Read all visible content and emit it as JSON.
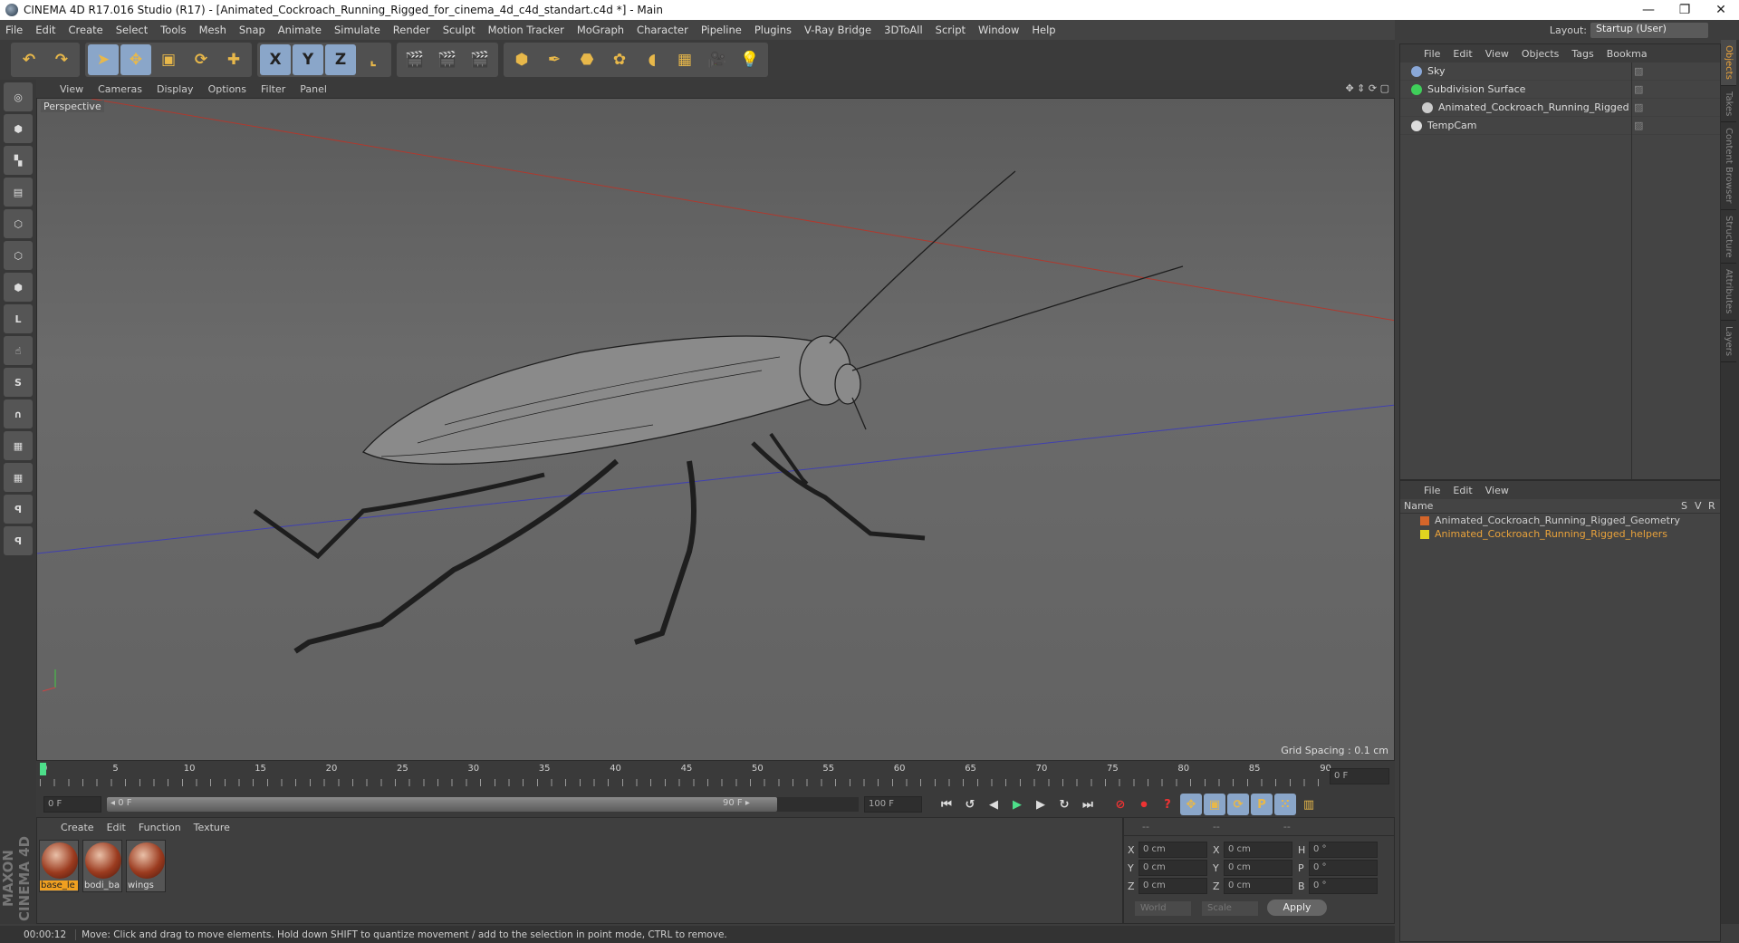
{
  "window": {
    "title": "CINEMA 4D R17.016 Studio (R17) - [Animated_Cockroach_Running_Rigged_for_cinema_4d_c4d_standart.c4d *] - Main",
    "minimize": "—",
    "restore": "❐",
    "close": "✕"
  },
  "menu": [
    "File",
    "Edit",
    "Create",
    "Select",
    "Tools",
    "Mesh",
    "Snap",
    "Animate",
    "Simulate",
    "Render",
    "Sculpt",
    "Motion Tracker",
    "MoGraph",
    "Character",
    "Pipeline",
    "Plugins",
    "V-Ray Bridge",
    "3DToAll",
    "Script",
    "Window",
    "Help"
  ],
  "toolbar": {
    "groups": [
      [
        {
          "icon": "undo-icon",
          "g": "↶"
        },
        {
          "icon": "redo-icon",
          "g": "↷"
        }
      ],
      [
        {
          "icon": "select-arrow-icon",
          "g": "➤",
          "sel": true
        },
        {
          "icon": "move-icon",
          "g": "✥",
          "sel": true
        },
        {
          "icon": "scale-icon",
          "g": "▣"
        },
        {
          "icon": "rotate-icon",
          "g": "⟳"
        },
        {
          "icon": "transform-icon",
          "g": "✚"
        }
      ],
      [
        {
          "icon": "x-axis-icon",
          "g": "X",
          "sel": true
        },
        {
          "icon": "y-axis-icon",
          "g": "Y",
          "sel": true
        },
        {
          "icon": "z-axis-icon",
          "g": "Z",
          "sel": true
        },
        {
          "icon": "coordinate-system-icon",
          "g": "⌞"
        }
      ],
      [
        {
          "icon": "render-view-icon",
          "g": "🎬"
        },
        {
          "icon": "render-picture-viewer-icon",
          "g": "🎬"
        },
        {
          "icon": "render-settings-icon",
          "g": "🎬"
        }
      ],
      [
        {
          "icon": "cube-icon",
          "g": "⬢"
        },
        {
          "icon": "pen-spline-icon",
          "g": "✒"
        },
        {
          "icon": "subdivision-icon",
          "g": "⬣"
        },
        {
          "icon": "cloner-icon",
          "g": "✿"
        },
        {
          "icon": "deformer-icon",
          "g": "◖"
        },
        {
          "icon": "floor-icon",
          "g": "▦"
        },
        {
          "icon": "camera-icon",
          "g": "🎥"
        },
        {
          "icon": "light-icon",
          "g": "💡"
        }
      ]
    ]
  },
  "left_tools": [
    {
      "icon": "make-editable-icon",
      "g": "◎"
    },
    {
      "icon": "model-mode-icon",
      "g": "⬢"
    },
    {
      "icon": "texture-mode-icon",
      "g": "▚"
    },
    {
      "icon": "workplane-icon",
      "g": "▤"
    },
    {
      "icon": "points-mode-icon",
      "g": "⬡"
    },
    {
      "icon": "edges-mode-icon",
      "g": "⬡"
    },
    {
      "icon": "polygons-mode-icon",
      "g": "⬢"
    },
    {
      "icon": "axis-icon",
      "g": "L"
    },
    {
      "icon": "tweak-icon",
      "g": "☝"
    },
    {
      "icon": "solo-icon",
      "g": "S"
    },
    {
      "icon": "magnet-icon",
      "g": "∩"
    },
    {
      "icon": "snap-grid-icon",
      "g": "▦"
    },
    {
      "icon": "snap-settings-icon",
      "g": "▦"
    },
    {
      "icon": "python-icon",
      "g": "ꟼ"
    },
    {
      "icon": "python-2-icon",
      "g": "ꟼ"
    }
  ],
  "viewport": {
    "menu": [
      "View",
      "Cameras",
      "Display",
      "Options",
      "Filter",
      "Panel"
    ],
    "camera_label": "Perspective",
    "grid_spacing": "Grid Spacing : 0.1 cm",
    "nav_icons": "✥ ⇕ ⟳ ▢"
  },
  "timeline": {
    "ticks": [
      "0",
      "5",
      "10",
      "15",
      "20",
      "25",
      "30",
      "35",
      "40",
      "45",
      "50",
      "55",
      "60",
      "65",
      "70",
      "75",
      "80",
      "85",
      "90"
    ],
    "current_frame_field": "0 F",
    "start_field": "0 F",
    "range_start": "◂ 0 F",
    "range_end": "90 F ▸",
    "end_field": "100 F",
    "transport": [
      {
        "icon": "goto-start-icon",
        "g": "⏮"
      },
      {
        "icon": "prev-key-icon",
        "g": "↺"
      },
      {
        "icon": "prev-frame-icon",
        "g": "◀"
      },
      {
        "icon": "play-icon",
        "g": "▶"
      },
      {
        "icon": "next-frame-icon",
        "g": "▶"
      },
      {
        "icon": "next-key-icon",
        "g": "↻"
      },
      {
        "icon": "goto-end-icon",
        "g": "⏭"
      }
    ],
    "key_tools": [
      {
        "icon": "record-disabled-icon",
        "g": "⊘"
      },
      {
        "icon": "record-icon",
        "g": "⏺"
      },
      {
        "icon": "autokey-icon",
        "g": "?"
      },
      {
        "icon": "key-position-icon",
        "g": "✥"
      },
      {
        "icon": "key-scale-icon",
        "g": "▣"
      },
      {
        "icon": "key-rotation-icon",
        "g": "⟳"
      },
      {
        "icon": "key-parameter-icon",
        "g": "P"
      },
      {
        "icon": "key-pla-icon",
        "g": "⁙"
      },
      {
        "icon": "timeline-window-icon",
        "g": "▥"
      }
    ]
  },
  "materials": {
    "menu": [
      "Create",
      "Edit",
      "Function",
      "Texture"
    ],
    "items": [
      "base_le",
      "bodi_ba",
      "wings"
    ]
  },
  "brand": "MAXON CINEMA 4D",
  "coords": {
    "headers": [
      "--",
      "--",
      "--"
    ],
    "rows": [
      [
        "X",
        "0 cm",
        "X",
        "0 cm",
        "H",
        "0 °"
      ],
      [
        "Y",
        "0 cm",
        "Y",
        "0 cm",
        "P",
        "0 °"
      ],
      [
        "Z",
        "0 cm",
        "Z",
        "0 cm",
        "B",
        "0 °"
      ]
    ],
    "mode": "World",
    "type": "Scale",
    "apply": "Apply"
  },
  "status": {
    "time": "00:00:12",
    "message": "Move: Click and drag to move elements. Hold down SHIFT to quantize movement / add to the selection in point mode, CTRL to remove."
  },
  "layout": {
    "label": "Layout:",
    "value": "Startup (User)"
  },
  "objects": {
    "menu": [
      "File",
      "Edit",
      "View",
      "Objects",
      "Tags",
      "Bookma"
    ],
    "items": [
      {
        "name": "Sky",
        "color": "#8aa8d8",
        "indent": 0
      },
      {
        "name": "Subdivision Surface",
        "color": "#3fcf5a",
        "indent": 0
      },
      {
        "name": "Animated_Cockroach_Running_Rigged",
        "color": "#cccccc",
        "indent": 1
      },
      {
        "name": "TempCam",
        "color": "#dddddd",
        "indent": 0
      }
    ]
  },
  "layers": {
    "menu": [
      "File",
      "Edit",
      "View"
    ],
    "headers": {
      "name": "Name",
      "s": "S",
      "v": "V",
      "r": "R"
    },
    "items": [
      {
        "name": "Animated_Cockroach_Running_Rigged_Geometry",
        "color": "#d4652a",
        "text": "#cfcfcf"
      },
      {
        "name": "Animated_Cockroach_Running_Rigged_helpers",
        "color": "#e0d520",
        "text": "#e9a23b"
      }
    ]
  },
  "side_tabs": [
    "Objects",
    "Takes",
    "Content Browser",
    "Structure",
    "Attributes",
    "Layers"
  ]
}
